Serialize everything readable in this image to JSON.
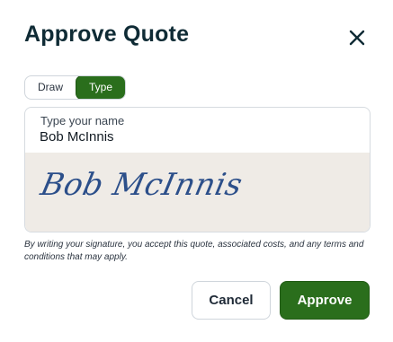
{
  "dialog": {
    "title": "Approve Quote"
  },
  "mode_toggle": {
    "options": [
      "Draw",
      "Type"
    ],
    "selected": "Type"
  },
  "name_field": {
    "label": "Type your name",
    "value": "Bob McInnis"
  },
  "signature_preview": {
    "text": "Bob McInnis"
  },
  "disclaimer": "By writing your signature, you accept this quote, associated costs, and any terms and conditions that may apply.",
  "buttons": {
    "cancel": "Cancel",
    "approve": "Approve"
  },
  "colors": {
    "accent": "#2a6e1c",
    "signature": "#2c4f8a",
    "preview_background": "#efebe6",
    "title": "#0f2b35"
  },
  "icons": {
    "close": "close-icon"
  }
}
